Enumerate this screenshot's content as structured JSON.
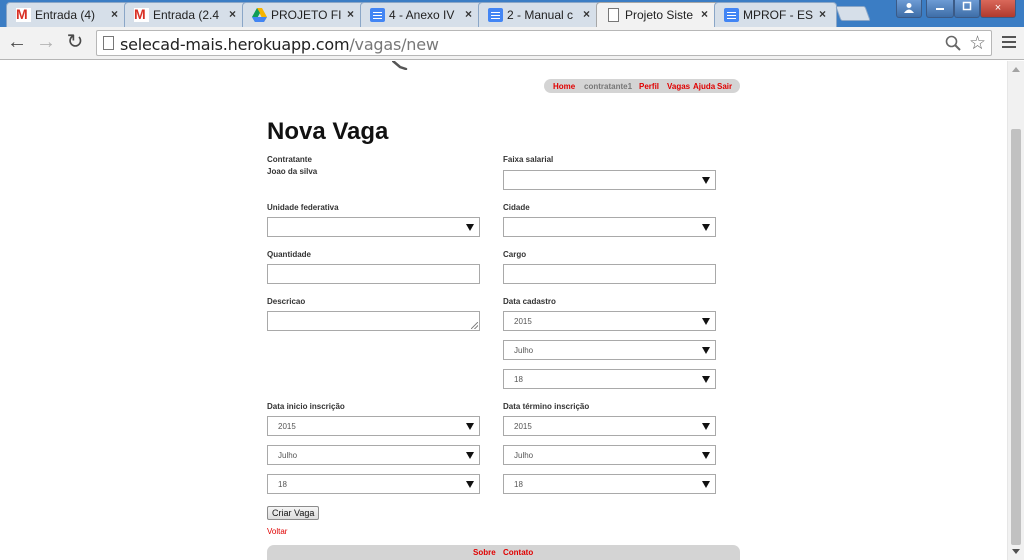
{
  "tabs": [
    {
      "title": "Entrada (4)",
      "icon": "gmail-icon"
    },
    {
      "title": "Entrada (2.4",
      "icon": "gmail-icon"
    },
    {
      "title": "PROJETO FI",
      "icon": "drive-icon"
    },
    {
      "title": "4 - Anexo IV",
      "icon": "docs-icon"
    },
    {
      "title": "2 - Manual c",
      "icon": "docs-icon"
    },
    {
      "title": "Projeto Siste",
      "icon": "page-icon",
      "active": true
    },
    {
      "title": "MPROF - ES",
      "icon": "docs-icon"
    }
  ],
  "tab_close_glyph": "×",
  "window_controls": {
    "user": "user-icon",
    "minimize": "minimize-icon",
    "maximize": "maximize-icon",
    "close": "×"
  },
  "toolbar": {
    "back": "←",
    "forward": "→",
    "reload": "↻",
    "url_host": "selecad-mais.herokuapp.com",
    "url_path": "/vagas/new",
    "star": "☆"
  },
  "topnav": {
    "home": "Home",
    "user": "contratante1",
    "perfil": "Perfil",
    "vagas": "Vagas",
    "ajuda": "Ajuda",
    "sair": "Sair"
  },
  "page": {
    "title": "Nova Vaga",
    "contratante_label": "Contratante",
    "contratante_value": "Joao da silva",
    "faixa_label": "Faixa salarial",
    "faixa_value": "",
    "uf_label": "Unidade federativa",
    "uf_value": "",
    "cidade_label": "Cidade",
    "cidade_value": "",
    "quantidade_label": "Quantidade",
    "quantidade_value": "",
    "cargo_label": "Cargo",
    "cargo_value": "",
    "descricao_label": "Descricao",
    "descricao_value": "",
    "data_cadastro_label": "Data cadastro",
    "data_cadastro": {
      "year": "2015",
      "month": "Julho",
      "day": "18"
    },
    "data_inicio_label": "Data inicio inscrição",
    "data_inicio": {
      "year": "2015",
      "month": "Julho",
      "day": "18"
    },
    "data_termino_label": "Data término inscrição",
    "data_termino": {
      "year": "2015",
      "month": "Julho",
      "day": "18"
    },
    "submit_label": "Criar Vaga",
    "back_label": "Voltar"
  },
  "footer": {
    "sobre": "Sobre",
    "contato": "Contato"
  },
  "colors": {
    "link_red": "#e00000",
    "nav_bar_gray": "#d4d4d4",
    "chrome_frame_blue": "#3b7dc4"
  }
}
